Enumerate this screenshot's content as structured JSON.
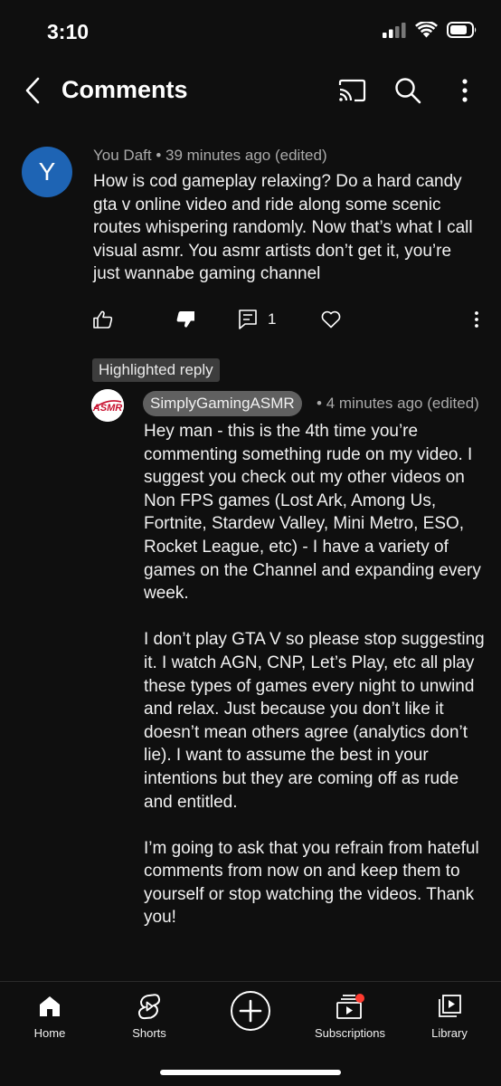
{
  "status_bar": {
    "time": "3:10"
  },
  "header": {
    "title": "Comments"
  },
  "comment": {
    "avatar_letter": "Y",
    "author": "You Daft",
    "time": "39 minutes ago (edited)",
    "text": "How is cod gameplay relaxing? Do a hard candy gta v online video and ride along some scenic routes whispering randomly. Now that’s what I call visual asmr. You asmr artists don’t get it, you’re just wannabe gaming channel",
    "reply_count": "1",
    "avatar_color": "#1e64b4"
  },
  "highlighted_label": "Highlighted reply",
  "reply": {
    "author": "SimplyGamingASMR",
    "avatar_text": "ASMR",
    "time": "4 minutes ago (edited)",
    "paragraph_1": "Hey man - this is the 4th time you’re commenting something rude on my video. I suggest you check out my other videos on Non FPS games (Lost Ark, Among Us, Fortnite, Stardew Valley, Mini Metro, ESO, Rocket League, etc) - I have a variety of games on the Channel and expanding every week.",
    "paragraph_2": "I don’t play GTA V so please stop suggesting it. I watch AGN, CNP, Let’s Play, etc all play these types of games every night to unwind and relax. Just because you don’t like it doesn’t mean others agree (analytics don’t lie). I want to assume the best in your intentions but they are coming off as rude and entitled.",
    "paragraph_3": "I’m going to ask that you refrain from hateful comments from now on and keep them to yourself or stop watching the videos. Thank you!"
  },
  "nav": {
    "home": "Home",
    "shorts": "Shorts",
    "subscriptions": "Subscriptions",
    "library": "Library"
  },
  "colors": {
    "background": "#0f0f0f",
    "notification_dot": "#ff3b30"
  }
}
